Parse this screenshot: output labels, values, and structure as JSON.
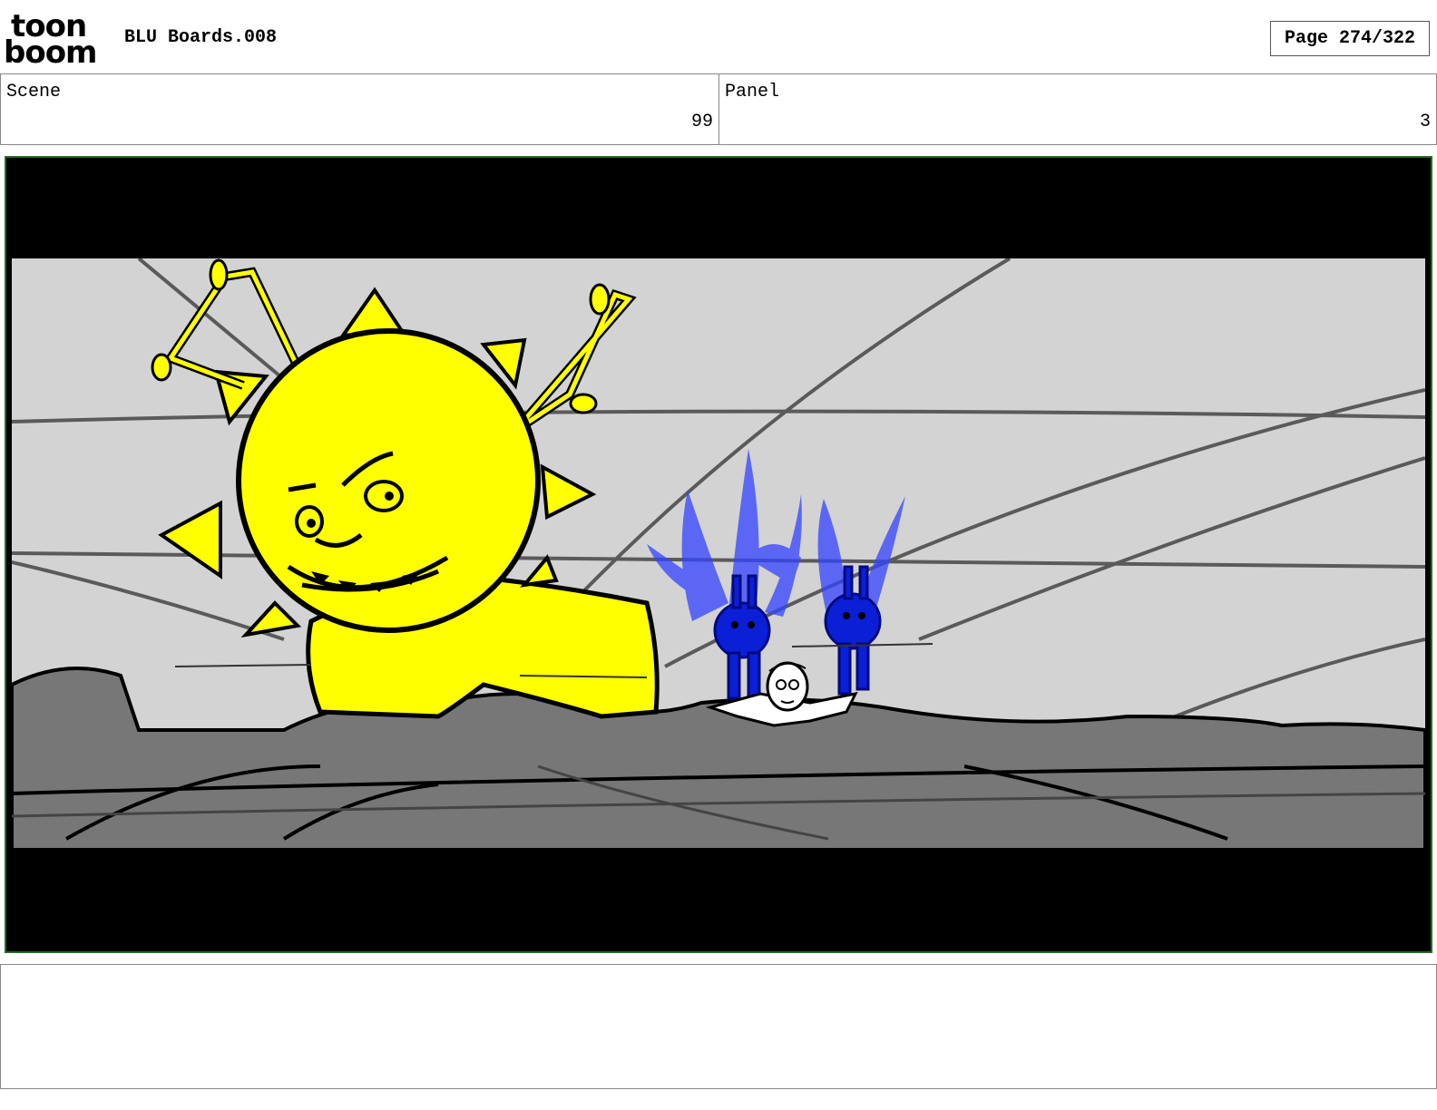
{
  "header": {
    "logo_top": "toon",
    "logo_bottom": "boom",
    "doc_title": "BLU Boards.008",
    "page_label": "Page 274/322"
  },
  "fields": {
    "scene_label": "Scene",
    "scene_value": "99",
    "panel_label": "Panel",
    "panel_value": "3"
  },
  "notes": {
    "text": ""
  }
}
